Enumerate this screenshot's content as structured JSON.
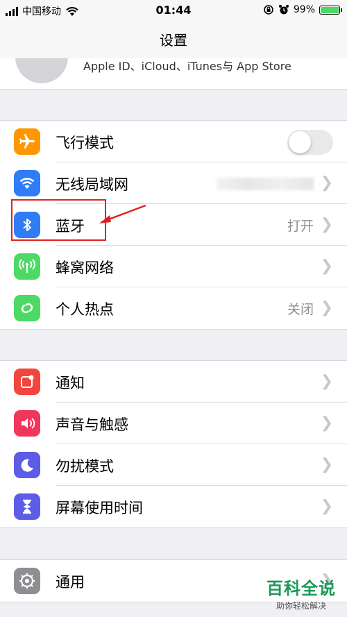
{
  "status_bar": {
    "carrier": "中国移动",
    "time": "01:44",
    "battery": "99%",
    "battery_level": 0.99
  },
  "nav": {
    "title": "设置"
  },
  "profile": {
    "subtitle": "Apple ID、iCloud、iTunes与 App Store"
  },
  "group1": [
    {
      "label": "飞行模式",
      "icon": "airplane-icon",
      "color": "#ff9500",
      "toggle": false
    },
    {
      "label": "无线局域网",
      "icon": "wifi-icon",
      "color": "#2f7cf6",
      "value": ""
    },
    {
      "label": "蓝牙",
      "icon": "bluetooth-icon",
      "color": "#2f7cf6",
      "value": "打开"
    },
    {
      "label": "蜂窝网络",
      "icon": "cellular-icon",
      "color": "#4cd964",
      "value": ""
    },
    {
      "label": "个人热点",
      "icon": "hotspot-icon",
      "color": "#4cd964",
      "value": "关闭"
    }
  ],
  "group2": [
    {
      "label": "通知",
      "icon": "notifications-icon",
      "color": "#f2453d"
    },
    {
      "label": "声音与触感",
      "icon": "sound-icon",
      "color": "#f0365a"
    },
    {
      "label": "勿扰模式",
      "icon": "moon-icon",
      "color": "#5d5ce6"
    },
    {
      "label": "屏幕使用时间",
      "icon": "hourglass-icon",
      "color": "#5d5ce6"
    }
  ],
  "group3": [
    {
      "label": "通用",
      "icon": "gear-icon",
      "color": "#8e8e93"
    }
  ],
  "watermark": {
    "title": "百科全说",
    "subtitle": "助你轻松解决"
  }
}
